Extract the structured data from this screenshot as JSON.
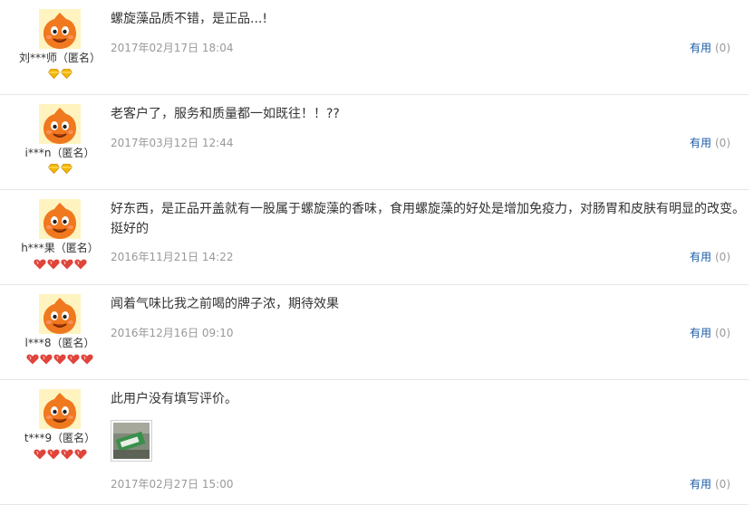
{
  "reviews": [
    {
      "username": "刘***师（匿名）",
      "badge_type": "diamond",
      "badge_count": 2,
      "content": "螺旋藻品质不错，是正品...!",
      "date": "2017年02月17日 18:04",
      "useful_label": "有用",
      "useful_count": "(0)"
    },
    {
      "username": "i***n（匿名）",
      "badge_type": "diamond",
      "badge_count": 2,
      "content": "老客户了，服务和质量都一如既往！！??",
      "date": "2017年03月12日 12:44",
      "useful_label": "有用",
      "useful_count": "(0)"
    },
    {
      "username": "h***果（匿名）",
      "badge_type": "heart",
      "badge_count": 4,
      "content": "好东西，是正品开盖就有一股属于螺旋藻的香味，食用螺旋藻的好处是增加免疫力，对肠胃和皮肤有明显的改变。挺好的",
      "date": "2016年11月21日 14:22",
      "useful_label": "有用",
      "useful_count": "(0)"
    },
    {
      "username": "l***8（匿名）",
      "badge_type": "heart",
      "badge_count": 5,
      "content": "闻着气味比我之前喝的牌子浓，期待效果",
      "date": "2016年12月16日 09:10",
      "useful_label": "有用",
      "useful_count": "(0)"
    },
    {
      "username": "t***9（匿名）",
      "badge_type": "heart",
      "badge_count": 4,
      "content": "此用户没有填写评价。",
      "date": "2017年02月27日 15:00",
      "useful_label": "有用",
      "useful_count": "(0)"
    }
  ],
  "colors": {
    "useful_link": "#1a5aa5",
    "date_text": "#999999",
    "avatar_orange": "#f0781e",
    "diamond_gold": "#f5b800",
    "heart_red": "#e0443a"
  },
  "icons": {
    "avatar": "orange-mascot-avatar-icon",
    "diamond": "yellow-diamond-icon",
    "heart": "red-heart-icon"
  }
}
